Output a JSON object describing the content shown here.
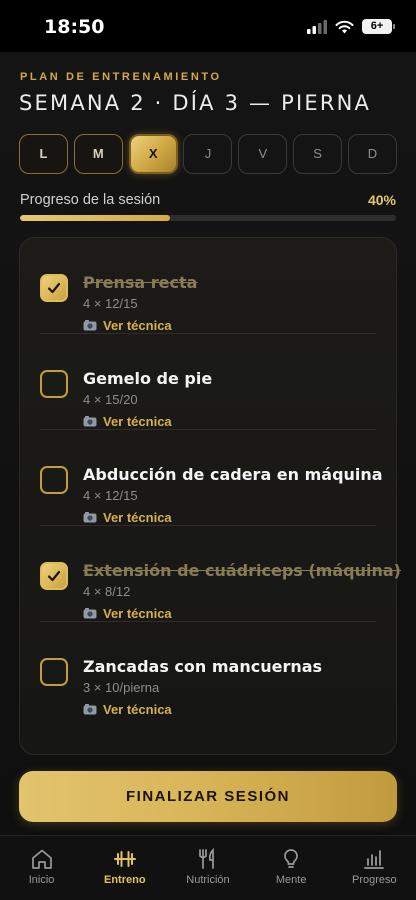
{
  "status": {
    "time": "18:50",
    "battery": "6+"
  },
  "header": {
    "kicker": "PLAN DE ENTRENAMIENTO",
    "title": "SEMANA 2 · DÍA 3 — PIERNA"
  },
  "days": [
    {
      "label": "L",
      "state": "done"
    },
    {
      "label": "M",
      "state": "done"
    },
    {
      "label": "X",
      "state": "active"
    },
    {
      "label": "J",
      "state": "dim"
    },
    {
      "label": "V",
      "state": "dim"
    },
    {
      "label": "S",
      "state": "dim"
    },
    {
      "label": "D",
      "state": "dim"
    }
  ],
  "progress": {
    "label": "Progreso de la sesión",
    "percent_label": "40%",
    "value": 0.4
  },
  "exercises": [
    {
      "name": "Prensa recta",
      "sets": "4 × 12/15",
      "technique": "Ver técnica",
      "done": true
    },
    {
      "name": "Gemelo de pie",
      "sets": "4 × 15/20",
      "technique": "Ver técnica",
      "done": false
    },
    {
      "name": "Abducción de cadera en máquina",
      "sets": "4 × 12/15",
      "technique": "Ver técnica",
      "done": false
    },
    {
      "name": "Extensión de cuádriceps (máquina)",
      "sets": "4 × 8/12",
      "technique": "Ver técnica",
      "done": true
    },
    {
      "name": "Zancadas con mancuernas",
      "sets": "3 × 10/pierna",
      "technique": "Ver técnica",
      "done": false
    }
  ],
  "finish_button": "FINALIZAR SESIÓN",
  "tabs": [
    {
      "label": "Inicio",
      "icon": "home-icon",
      "active": false
    },
    {
      "label": "Entreno",
      "icon": "dumbbell-icon",
      "active": true
    },
    {
      "label": "Nutrición",
      "icon": "fork-knife-icon",
      "active": false
    },
    {
      "label": "Mente",
      "icon": "lightbulb-icon",
      "active": false
    },
    {
      "label": "Progreso",
      "icon": "bar-chart-icon",
      "active": false
    }
  ],
  "colors": {
    "accent": "#d4a94a",
    "background": "#121212"
  }
}
